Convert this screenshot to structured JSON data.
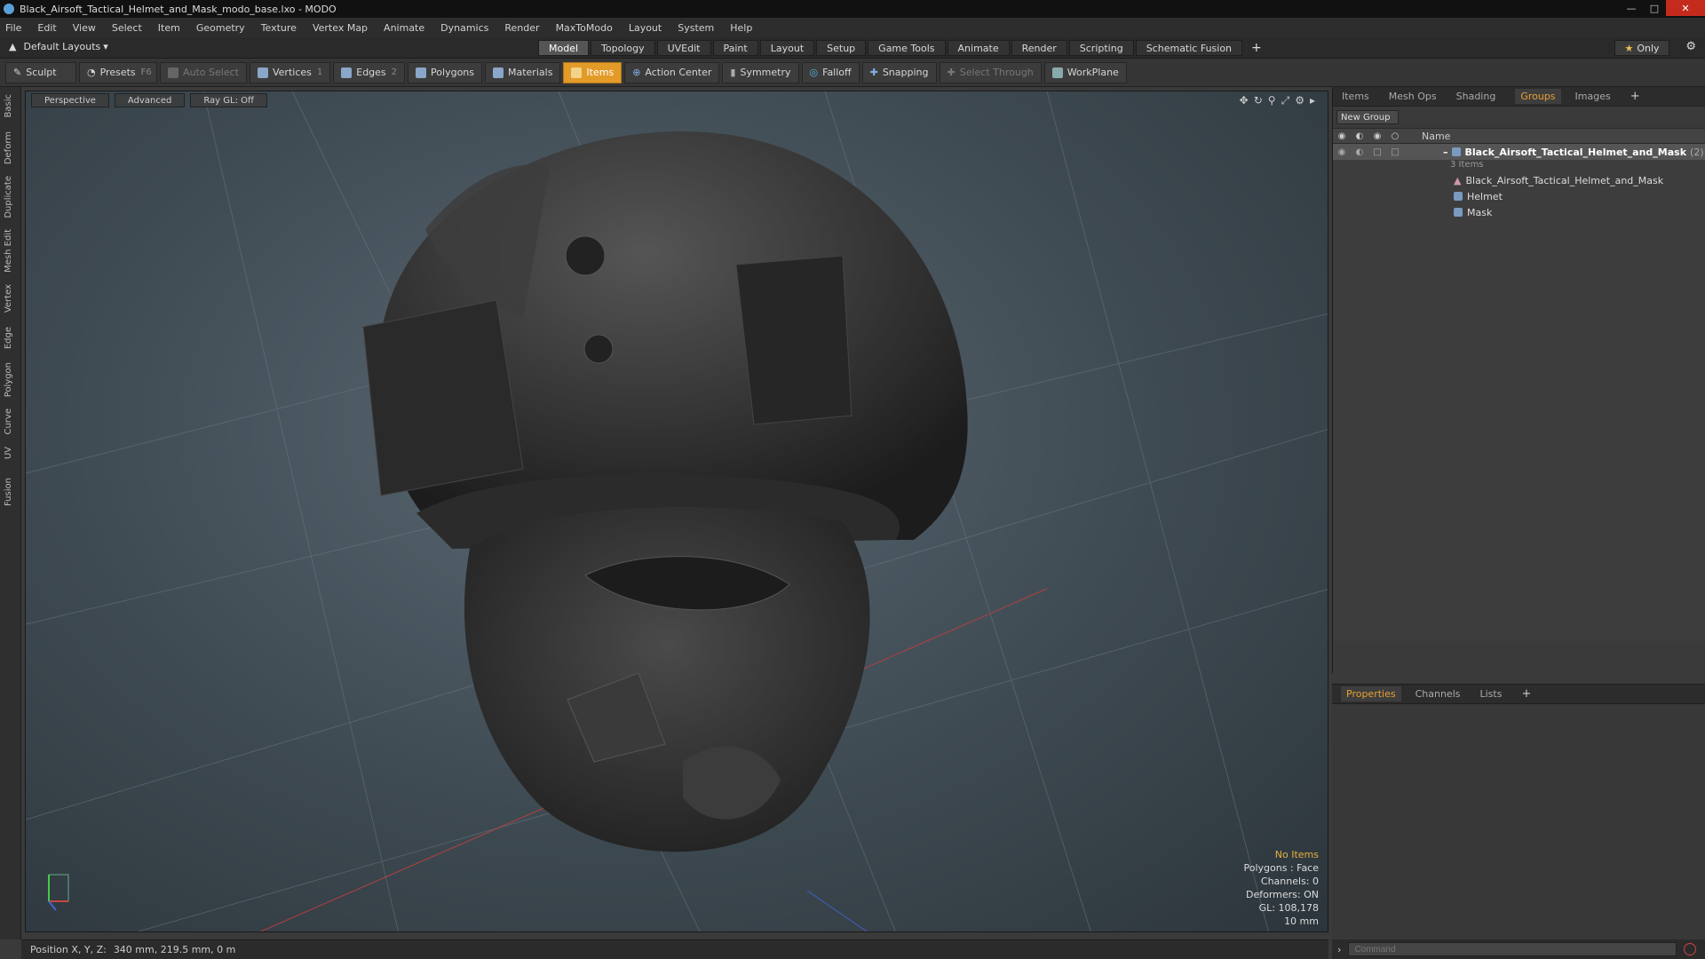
{
  "window": {
    "title": "Black_Airsoft_Tactical_Helmet_and_Mask_modo_base.lxo - MODO"
  },
  "menu": [
    "File",
    "Edit",
    "View",
    "Select",
    "Item",
    "Geometry",
    "Texture",
    "Vertex Map",
    "Animate",
    "Dynamics",
    "Render",
    "MaxToModo",
    "Layout",
    "System",
    "Help"
  ],
  "layout": {
    "default_layouts": "Default Layouts",
    "tabs": [
      "Model",
      "Topology",
      "UVEdit",
      "Paint",
      "Layout",
      "Setup",
      "Game Tools",
      "Animate",
      "Render",
      "Scripting",
      "Schematic Fusion"
    ],
    "active_tab": "Model",
    "only_label": "Only"
  },
  "toolbar": {
    "sculpt": "Sculpt",
    "presets": "Presets",
    "presets_shortcut": "F6",
    "auto_select": "Auto Select",
    "vertices": "Vertices",
    "vertices_count": "1",
    "edges": "Edges",
    "edges_count": "2",
    "polygons": "Polygons",
    "materials": "Materials",
    "items": "Items",
    "action_center": "Action Center",
    "symmetry": "Symmetry",
    "falloff": "Falloff",
    "snapping": "Snapping",
    "select_through": "Select Through",
    "workplane": "WorkPlane"
  },
  "left_tabs": [
    "Basic",
    "Deform",
    "Duplicate",
    "Mesh Edit",
    "Vertex",
    "Edge",
    "Polygon",
    "Curve",
    "UV",
    "Fusion"
  ],
  "viewport": {
    "perspective": "Perspective",
    "advanced": "Advanced",
    "raygl": "Ray GL: Off",
    "stats": {
      "no_items": "No Items",
      "polygons": "Polygons : Face",
      "channels": "Channels: 0",
      "deformers": "Deformers: ON",
      "gl": "GL: 108,178",
      "unit": "10 mm"
    }
  },
  "status": {
    "label": "Position X, Y, Z:",
    "value": "340 mm, 219.5 mm, 0 m"
  },
  "groups_panel": {
    "tabs": [
      "Items",
      "Mesh Ops",
      "Shading",
      "Groups",
      "Images"
    ],
    "active_tab": "Groups",
    "new_group": "New Group",
    "name_header": "Name",
    "root": {
      "label": "Black_Airsoft_Tactical_Helmet_and_Mask",
      "count": "(2)",
      "sub": "3 Items"
    },
    "children": [
      "Black_Airsoft_Tactical_Helmet_and_Mask",
      "Helmet",
      "Mask"
    ]
  },
  "props_panel": {
    "tabs": [
      "Properties",
      "Channels",
      "Lists"
    ],
    "active_tab": "Properties"
  },
  "command": {
    "placeholder": "Command"
  },
  "colors": {
    "accent": "#e39b28",
    "viewport": "#3e4a52"
  }
}
